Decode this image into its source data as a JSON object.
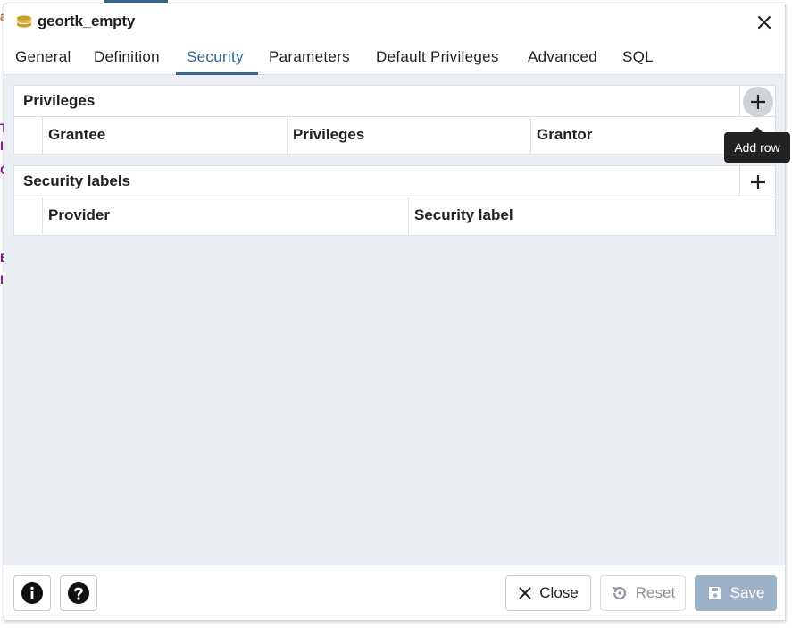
{
  "dialog": {
    "title": "geortk_empty",
    "icon": "database-icon"
  },
  "tabs": [
    {
      "label": "General"
    },
    {
      "label": "Definition"
    },
    {
      "label": "Security"
    },
    {
      "label": "Parameters"
    },
    {
      "label": "Default Privileges"
    },
    {
      "label": "Advanced"
    },
    {
      "label": "SQL"
    }
  ],
  "active_tab": "Security",
  "privileges": {
    "title": "Privileges",
    "columns": [
      "Grantee",
      "Privileges",
      "Grantor"
    ],
    "add_tooltip": "Add row"
  },
  "security_labels": {
    "title": "Security labels",
    "columns": [
      "Provider",
      "Security label"
    ]
  },
  "footer": {
    "close_label": "Close",
    "reset_label": "Reset",
    "save_label": "Save"
  },
  "colors": {
    "accent": "#326690",
    "save_bg": "#9cb1c6"
  }
}
